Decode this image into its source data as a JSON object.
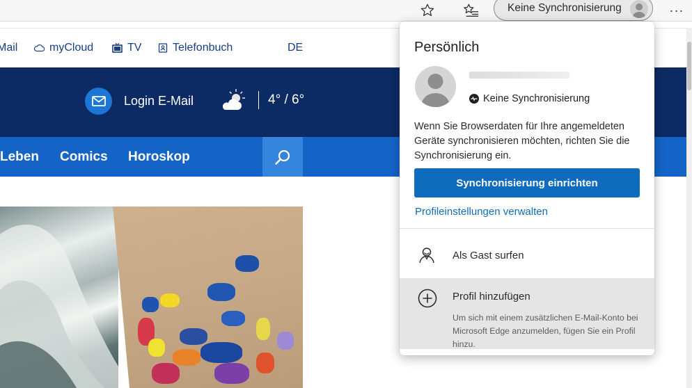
{
  "browser": {
    "sync_button_label": "Keine Synchronisierung",
    "more_label": "···"
  },
  "site": {
    "top_links": {
      "mail": "Mail",
      "mycloud": "myCloud",
      "tv": "TV",
      "telefonbuch": "Telefonbuch",
      "language": "DE"
    },
    "header": {
      "login_label": "Login E-Mail",
      "temperature": "4° / 6°"
    },
    "nav": {
      "leben": "Leben",
      "comics": "Comics",
      "horoskop": "Horoskop"
    }
  },
  "flyout": {
    "title": "Persönlich",
    "status": "Keine Synchronisierung",
    "description": "Wenn Sie Browserdaten für Ihre angemeldeten Geräte synchronisieren möchten, richten Sie die Synchronisierung ein.",
    "sync_button": "Synchronisierung einrichten",
    "manage_link": "Profileinstellungen verwalten",
    "guest_label": "Als Gast surfen",
    "add_profile_label": "Profil hinzufügen",
    "add_profile_desc": "Um sich mit einem zusätzlichen E-Mail-Konto bei Microsoft Edge anzumelden, fügen Sie ein Profil hinzu."
  },
  "colors": {
    "header_dark": "#0c2b64",
    "nav_blue": "#1464c8",
    "accent": "#0f6cbd"
  }
}
